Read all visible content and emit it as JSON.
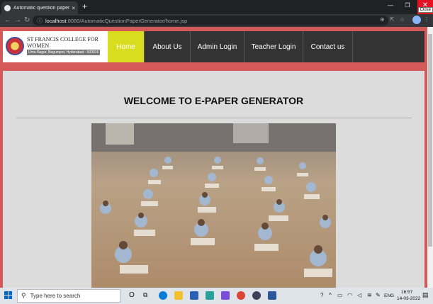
{
  "browser": {
    "tab_title": "Automatic question paper gene",
    "tab_close": "×",
    "new_tab": "+",
    "window_close_tooltip": "Close",
    "url_host": "localhost",
    "url_path": ":8080/AutomaticQuestionPaperGenerator/home.jsp"
  },
  "site": {
    "college_name": "ST FRANCIS COLLEGE FOR WOMEN",
    "college_address": "Uma Nagar, Begumpet, Hyderabad - 500016",
    "nav": [
      {
        "label": "Home",
        "active": true
      },
      {
        "label": "About Us"
      },
      {
        "label": "Admin Login"
      },
      {
        "label": "Teacher Login"
      },
      {
        "label": "Contact us"
      }
    ],
    "welcome": "WELCOME TO E-PAPER GENERATOR",
    "nav_active_color": "#d9dd1f",
    "page_border_color": "#d45a5a"
  },
  "taskbar": {
    "search_placeholder": "Type here to search",
    "language": "ENG",
    "time": "16:57",
    "date": "14-03-2022"
  }
}
